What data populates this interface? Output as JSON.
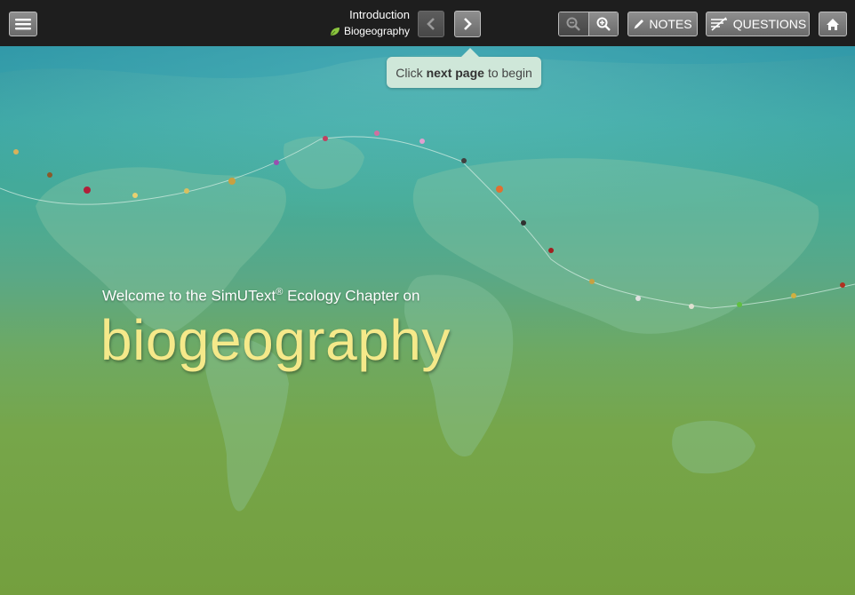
{
  "toolbar": {
    "title": "Introduction",
    "subtitle": "Biogeography",
    "notes_label": "NOTES",
    "questions_label": "QUESTIONS"
  },
  "icons": {
    "menu": "hamburger-icon",
    "prev": "chevron-left-icon",
    "next": "chevron-right-icon",
    "zoom_out": "zoom-out-icon",
    "zoom_in": "zoom-in-icon",
    "notes": "pencil-icon",
    "questions": "questions-icon",
    "home": "home-icon",
    "subtitle": "leaf-icon"
  },
  "tooltip": {
    "prefix": "Click",
    "bold": "next page",
    "suffix": "to begin"
  },
  "hero": {
    "welcome_prefix": "Welcome to the SimUText",
    "welcome_reg": "®",
    "welcome_suffix": " Ecology Chapter on",
    "title": "biogeography"
  },
  "colors": {
    "toolbar_bg": "#1e1e1e",
    "title_accent": "#f5e98a",
    "tooltip_bg": "#cfe7d9"
  }
}
